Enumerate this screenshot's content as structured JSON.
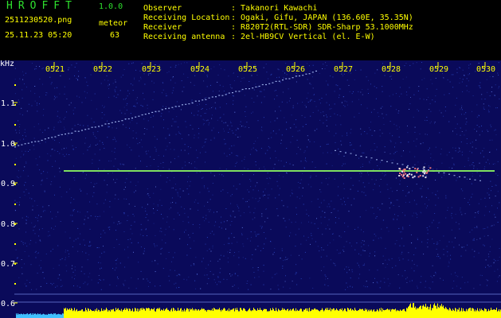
{
  "header": {
    "app_title": "HROFFT",
    "app_version": "1.0.0",
    "file_name": "2511230520.png",
    "date_time": "25.11.23 05:20",
    "meteor_label": "meteor",
    "meteor_count": "63",
    "info": [
      {
        "key": "Observer",
        "value": ": Takanori Kawachi"
      },
      {
        "key": "Receiving Location",
        "value": ": Ogaki, Gifu, JAPAN (136.60E, 35.35N)"
      },
      {
        "key": "Receiver",
        "value": ": R820T2(RTL-SDR) SDR-Sharp 53.1000MHz"
      },
      {
        "key": "Receiving antenna",
        "value": ": 2el-HB9CV Vertical (el. E-W)"
      }
    ]
  },
  "spectrogram": {
    "y_unit": "kHz",
    "y_ticks": [
      "1.1",
      "1.0",
      "0.9",
      "0.8",
      "0.7",
      "0.6"
    ],
    "time_ticks": [
      "0521",
      "0522",
      "0523",
      "0524",
      "0525",
      "0526",
      "0527",
      "0528",
      "0529",
      "0530"
    ],
    "colors": {
      "background": "#0a0a5a",
      "noise": "#3050d0",
      "carrier": "#90ff60",
      "echo": "#b0c8ff",
      "level": "#ffff00",
      "level_low": "#40c0ff",
      "tick_label": "#ffff00",
      "axis_label": "#ffffff"
    }
  }
}
